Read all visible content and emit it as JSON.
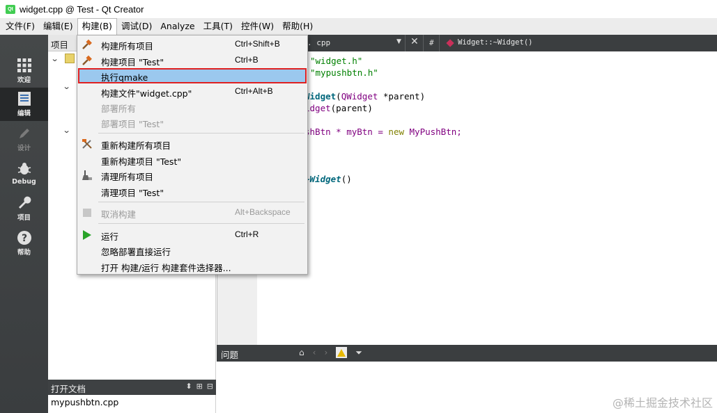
{
  "window": {
    "title": "widget.cpp @ Test - Qt Creator",
    "app_icon_text": "Qt"
  },
  "menubar": [
    {
      "label": "文件(F)"
    },
    {
      "label": "编辑(E)"
    },
    {
      "label": "构建(B)"
    },
    {
      "label": "调试(D)"
    },
    {
      "label": "Analyze"
    },
    {
      "label": "工具(T)"
    },
    {
      "label": "控件(W)"
    },
    {
      "label": "帮助(H)"
    }
  ],
  "modes": [
    {
      "label": "欢迎",
      "icon": "grid-icon"
    },
    {
      "label": "编辑",
      "icon": "document-icon"
    },
    {
      "label": "设计",
      "icon": "pencil-icon"
    },
    {
      "label": "Debug",
      "icon": "bug-icon"
    },
    {
      "label": "项目",
      "icon": "wrench-icon"
    },
    {
      "label": "帮助",
      "icon": "help-icon"
    }
  ],
  "projects_pane": {
    "title": "项目"
  },
  "open_documents": {
    "title": "打开文档",
    "items": [
      "mypushbtn.cpp"
    ]
  },
  "editor_toolbar": {
    "file": ". cpp",
    "hash": "#",
    "symbol": "Widget::~Widget()"
  },
  "code": {
    "line1": "\"widget.h\"",
    "line2": "\"mypushbtn.h\"",
    "line3_fn": "Widget",
    "line3_open": "(",
    "line3_type": "QWidget",
    "line3_rest": " *parent)",
    "line4_fn": "idget",
    "line4_rest": "(parent)",
    "line5_a": "shBtn * myBtn = ",
    "line5_kw": "new",
    "line5_b": " MyPushBtn;",
    "line6_fn": "~Widget",
    "line6_rest": "()"
  },
  "issues": {
    "title": "问题"
  },
  "watermark": "@稀土掘金技术社区",
  "build_menu": {
    "items": [
      {
        "label": "构建所有项目",
        "shortcut": "Ctrl+Shift+B",
        "icon": "hammer-icon"
      },
      {
        "label": "构建项目 \"Test\"",
        "shortcut": "Ctrl+B",
        "icon": "hammer-icon"
      },
      {
        "label": "执行qmake",
        "shortcut": ""
      },
      {
        "label": "构建文件\"widget.cpp\"",
        "shortcut": "Ctrl+Alt+B"
      },
      {
        "label": "部署所有",
        "shortcut": ""
      },
      {
        "label": "部署项目 \"Test\"",
        "shortcut": ""
      },
      {
        "label": "重新构建所有项目",
        "shortcut": "",
        "icon": "hammer-wrench-icon"
      },
      {
        "label": "重新构建项目 \"Test\"",
        "shortcut": ""
      },
      {
        "label": "清理所有项目",
        "shortcut": "",
        "icon": "broom-icon"
      },
      {
        "label": "清理项目 \"Test\"",
        "shortcut": ""
      },
      {
        "label": "取消构建",
        "shortcut": "Alt+Backspace",
        "icon": "stop-icon"
      },
      {
        "label": "运行",
        "shortcut": "Ctrl+R",
        "icon": "play-icon"
      },
      {
        "label": "忽略部署直接运行",
        "shortcut": ""
      },
      {
        "label": "打开 构建/运行 构建套件选择器...",
        "shortcut": ""
      }
    ]
  }
}
